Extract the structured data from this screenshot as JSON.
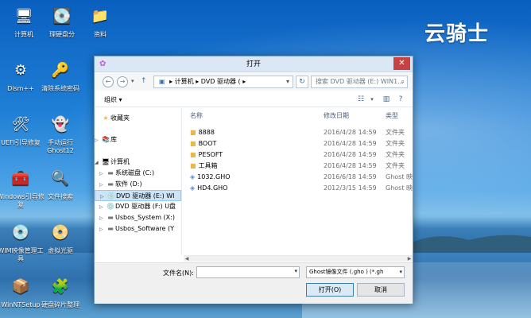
{
  "desktop": {
    "brand": "云骑士",
    "icons": [
      {
        "label": "计算机",
        "glyph": "🖥"
      },
      {
        "label": "理硬盘分",
        "glyph": "💽"
      },
      {
        "label": "资料",
        "glyph": "📁"
      },
      {
        "label": "Dism++",
        "glyph": "⚙"
      },
      {
        "label": "清除系统密码",
        "glyph": "🔑"
      },
      {
        "label": "UEFI引导修复",
        "glyph": "🛠"
      },
      {
        "label": "手动运行Ghost12",
        "glyph": "👻"
      },
      {
        "label": "Windows引导修复",
        "glyph": "🧰"
      },
      {
        "label": "文件搜索",
        "glyph": "🔍"
      },
      {
        "label": "WIM映像管理工具",
        "glyph": "💿"
      },
      {
        "label": "虚拟光驱",
        "glyph": "📀"
      },
      {
        "label": "WinNTSetup",
        "glyph": "📦"
      },
      {
        "label": "硬盘碎片整理",
        "glyph": "🧩"
      }
    ]
  },
  "dialog": {
    "title": "打开",
    "address": {
      "computer": "计算机",
      "sep": "▸",
      "drive": "DVD 驱动器 (",
      "more": "‹"
    },
    "search_placeholder": "搜索 DVD 驱动器 (E:) WIN1...",
    "organize": "组织 ▾",
    "nav": [
      {
        "label": "收藏夹",
        "arrow": "",
        "icon": "★"
      },
      {
        "label": "库",
        "arrow": "▷",
        "icon": "📚"
      },
      {
        "label": "计算机",
        "arrow": "◢",
        "icon": "🖥"
      },
      {
        "label": "系统磁盘 (C:)",
        "arrow": "▷",
        "icon": "▬"
      },
      {
        "label": "软件 (D:)",
        "arrow": "▷",
        "icon": "▬"
      },
      {
        "label": "DVD 驱动器 (E:) WI",
        "arrow": "▷",
        "icon": "💿"
      },
      {
        "label": "DVD 驱动器 (F:) U盘",
        "arrow": "▷",
        "icon": "💿"
      },
      {
        "label": "Usbos_System (X:)",
        "arrow": "▷",
        "icon": "▬"
      },
      {
        "label": "Usbos_Software (Y",
        "arrow": "▷",
        "icon": "▬"
      }
    ],
    "columns": {
      "name": "名称",
      "date": "修改日期",
      "type": "类型"
    },
    "files": [
      {
        "name": "8888",
        "date": "2016/4/28 14:59",
        "type": "文件夹",
        "kind": "folder"
      },
      {
        "name": "BOOT",
        "date": "2016/4/28 14:59",
        "type": "文件夹",
        "kind": "folder"
      },
      {
        "name": "PESOFT",
        "date": "2016/4/28 14:59",
        "type": "文件夹",
        "kind": "folder"
      },
      {
        "name": "工具箱",
        "date": "2016/4/28 14:59",
        "type": "文件夹",
        "kind": "folder"
      },
      {
        "name": "1032.GHO",
        "date": "2016/6/18 14:59",
        "type": "Ghost 映",
        "kind": "file"
      },
      {
        "name": "HD4.GHO",
        "date": "2012/3/15 14:59",
        "type": "Ghost 映",
        "kind": "file"
      }
    ],
    "filename_label": "文件名(N):",
    "filename_value": "",
    "filetype": "Ghost镜像文件 (.gho ) (*.gh",
    "open_button": "打开(O)",
    "cancel_button": "取消"
  }
}
